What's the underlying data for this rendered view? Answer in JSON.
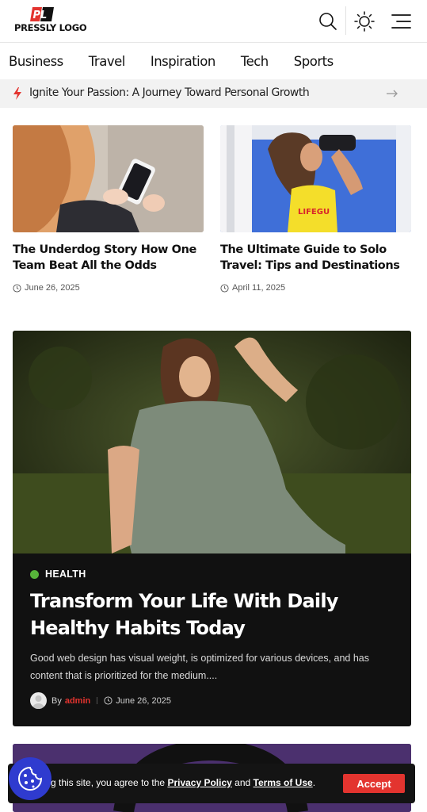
{
  "header": {
    "logo_mark": "PL",
    "logo_text": "PRESSLY LOGO",
    "icons": [
      "search-icon",
      "sun-icon",
      "menu-icon"
    ]
  },
  "nav": {
    "items": [
      {
        "label": "Business"
      },
      {
        "label": "Travel"
      },
      {
        "label": "Inspiration"
      },
      {
        "label": "Tech"
      },
      {
        "label": "Sports"
      }
    ]
  },
  "ticker": {
    "headline": "Ignite Your Passion: A Journey Toward Personal Growth",
    "icon": "bolt-icon",
    "accent": "#e3342f"
  },
  "cards": [
    {
      "title": "The Underdog Story How One Team Beat All the Odds",
      "date": "June 26, 2025"
    },
    {
      "title": "The Ultimate Guide to Solo Travel: Tips and Destinations",
      "date": "April 11, 2025",
      "image_text": "LIFEGU"
    }
  ],
  "featured": {
    "category": "HEALTH",
    "category_color": "#57b33a",
    "title": "Transform Your Life With Daily Healthy Habits Today",
    "excerpt": "Good web design has visual weight, is optimized for various devices, and has content that is prioritized for the medium....",
    "by": "By",
    "author": "admin",
    "date": "June 26, 2025"
  },
  "cookie": {
    "text_prefix": "g this site, you agree to the",
    "privacy": "Privacy Policy",
    "and": "and",
    "terms": "Terms of Use",
    "period": ".",
    "accept": "Accept",
    "accent": "#e3342f",
    "badge_color": "#2f3bcf"
  }
}
